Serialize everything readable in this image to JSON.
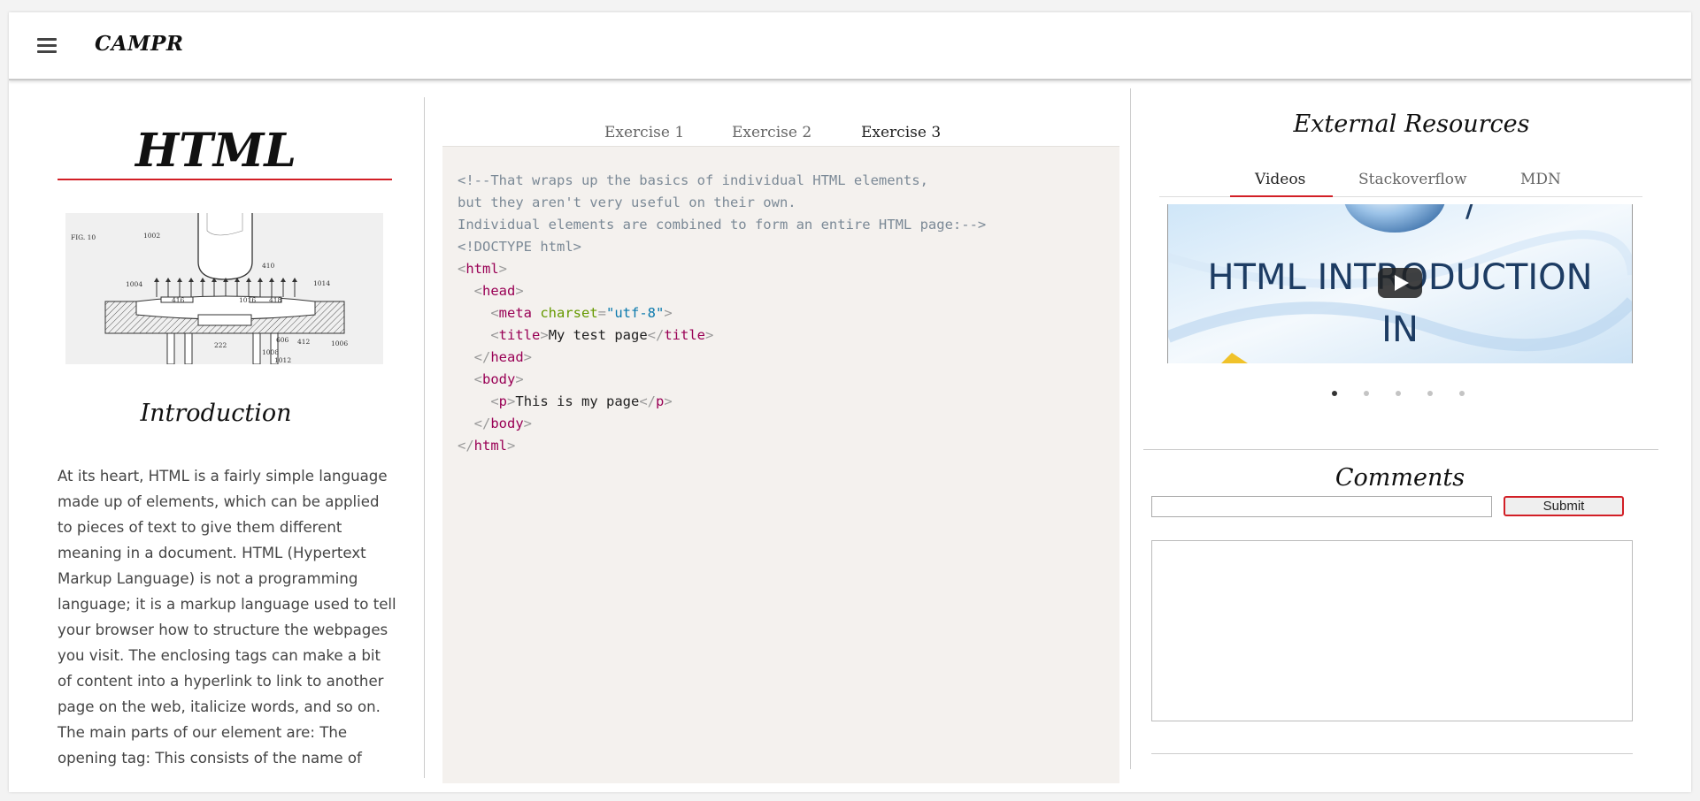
{
  "app": {
    "brand": "CAMPR"
  },
  "left": {
    "title": "HTML",
    "figure": {
      "caption": "FIG. 10",
      "labels": [
        "1002",
        "410",
        "1014",
        "1004",
        "1016",
        "418",
        "416",
        "1006",
        "412",
        "222",
        "606",
        "1008",
        "1012"
      ]
    },
    "intro_heading": "Introduction",
    "intro_text": "At its heart, HTML is a fairly simple language made up of elements, which can be applied to pieces of text to give them different meaning in a document. HTML (Hypertext Markup Language) is not a programming language; it is a markup language used to tell your browser how to structure the webpages you visit. The enclosing tags can make a bit of content into a hyperlink to link to another page on the web, italicize words, and so on. The main parts of our element are: The opening tag: This consists of the name of"
  },
  "middle": {
    "tabs": [
      {
        "label": "Exercise 1",
        "active": false
      },
      {
        "label": "Exercise 2",
        "active": false
      },
      {
        "label": "Exercise 3",
        "active": true
      }
    ],
    "code": {
      "comment1": "<!--That wraps up the basics of individual HTML elements,",
      "comment2": "but they aren't very useful on their own.",
      "comment3": "Individual elements are combined to form an entire HTML page:-->",
      "doctype": "<!DOCTYPE html>",
      "tag_html": "html",
      "tag_head": "head",
      "tag_meta": "meta",
      "attr_charset": "charset",
      "val_charset": "\"utf-8\"",
      "tag_title": "title",
      "title_text": "My test page",
      "tag_body": "body",
      "tag_p": "p",
      "p_text": "This is my page"
    }
  },
  "right": {
    "external_title": "External Resources",
    "tabs": [
      {
        "label": "Videos",
        "active": true
      },
      {
        "label": "Stackoverflow",
        "active": false
      },
      {
        "label": "MDN",
        "active": false
      }
    ],
    "video": {
      "title_line1": "HTML INTRODUCTION",
      "title_line2": "IN"
    },
    "carousel": {
      "count": 5,
      "active_index": 0
    },
    "comments_title": "Comments",
    "comment_input_value": "",
    "submit_label": "Submit",
    "comment_list": ""
  },
  "colors": {
    "accent": "#d21f26",
    "code_bg": "#f4f1ee",
    "tag": "#990055",
    "attr": "#669900",
    "value": "#0a79ad",
    "comment": "#7b8996"
  }
}
